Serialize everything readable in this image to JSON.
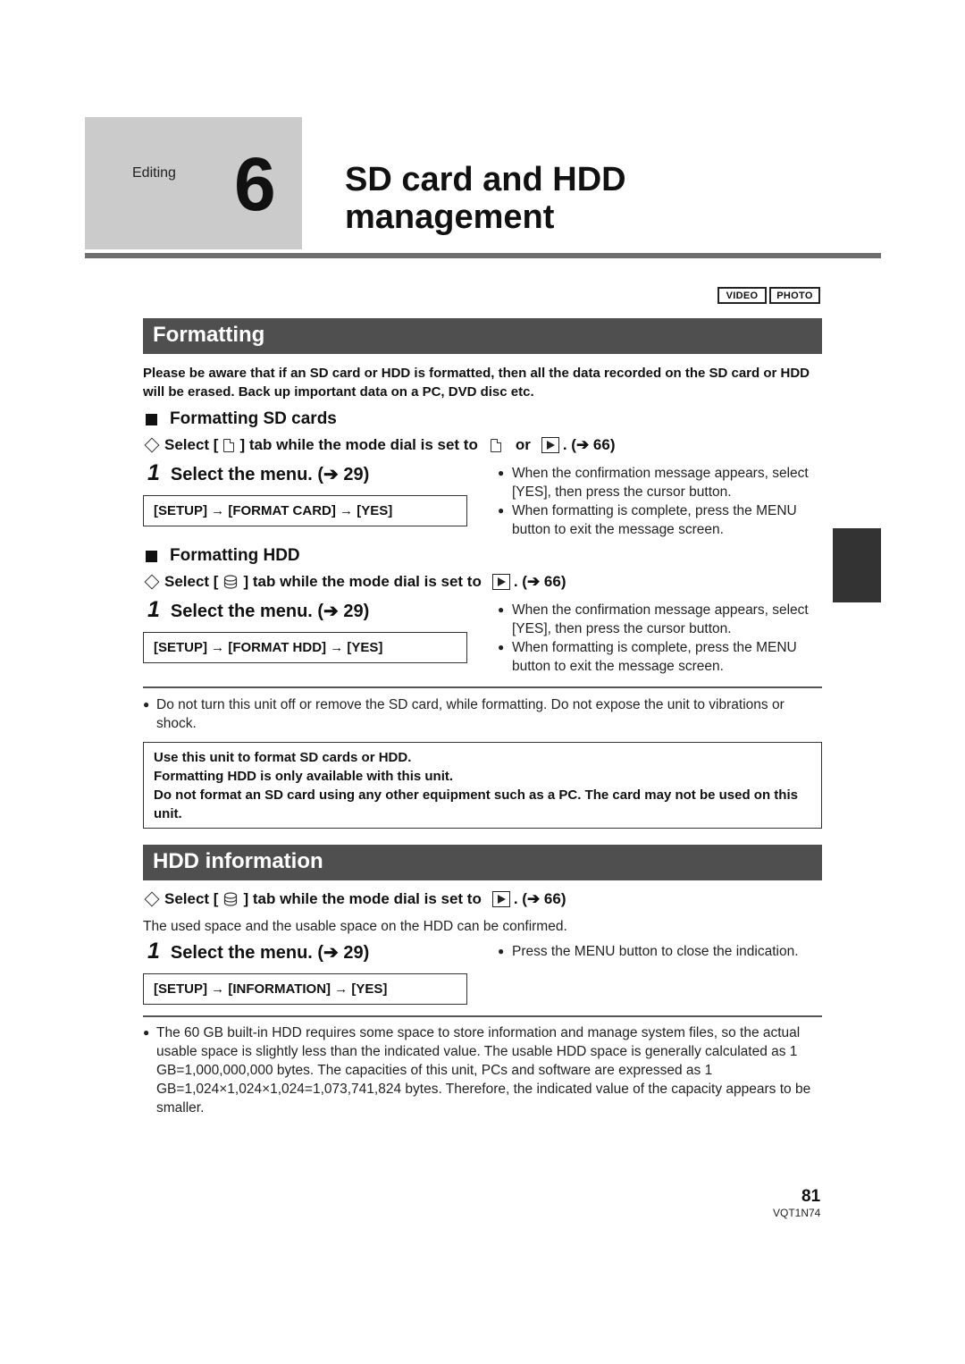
{
  "header": {
    "chapter_label": "Editing",
    "chapter_number": "6",
    "title_line1": "SD card and HDD",
    "title_line2": "management"
  },
  "mode_badges": [
    "VIDEO",
    "PHOTO"
  ],
  "formatting": {
    "section_title": "Formatting",
    "warning": "Please be aware that if an SD card or HDD is formatted, then all the data recorded on the SD card or HDD will be erased. Back up important data on a PC, DVD disc etc.",
    "sd": {
      "heading": "Formatting SD cards",
      "select_prefix": "Select [",
      "select_middle": "] tab while the mode dial is set to",
      "select_or": "or",
      "select_ref": ". (➔ 66)",
      "tab_icon": "sd-card-icon",
      "mode_icons": [
        "sd-card-icon",
        "playback-icon"
      ],
      "step_number": "1",
      "step_text": "Select the menu. (➔ 29)",
      "menu_path": "[SETUP] → [FORMAT CARD] → [YES]",
      "bullets": [
        "When the confirmation message appears, select [YES], then press the cursor button.",
        "When formatting is complete, press the MENU button to exit the message screen."
      ]
    },
    "hdd": {
      "heading": "Formatting HDD",
      "select_prefix": "Select [",
      "select_middle": "] tab while the mode dial is set to",
      "select_ref": ". (➔ 66)",
      "tab_icon": "hdd-icon",
      "mode_icons": [
        "playback-icon"
      ],
      "step_number": "1",
      "step_text": "Select the menu. (➔ 29)",
      "menu_path": "[SETUP] → [FORMAT HDD] → [YES]",
      "bullets": [
        "When the confirmation message appears, select [YES], then press the cursor button.",
        "When formatting is complete, press the MENU button to exit the message screen."
      ]
    },
    "note": "Do not turn this unit off or remove the SD card, while formatting. Do not expose the unit to vibrations or shock.",
    "notice_lines": [
      "Use this unit to format SD cards or HDD.",
      "Formatting HDD is only available with this unit.",
      "Do not format an SD card using any other equipment such as a PC. The card may not be used on this unit."
    ]
  },
  "hdd_information": {
    "section_title": "HDD information",
    "select_prefix": "Select [",
    "select_middle": "] tab while the mode dial is set to",
    "select_ref": ". (➔ 66)",
    "tab_icon": "hdd-icon",
    "mode_icons": [
      "playback-icon"
    ],
    "description": "The used space and the usable space on the HDD can be confirmed.",
    "step_number": "1",
    "step_text": "Select the menu. (➔ 29)",
    "menu_path": "[SETUP] → [INFORMATION] → [YES]",
    "bullets": [
      "Press the MENU button to close the indication."
    ],
    "note": "The 60 GB built-in HDD requires some space to store information and manage system files, so the actual usable space is slightly less than the indicated value. The usable HDD space is generally calculated as 1 GB=1,000,000,000 bytes. The capacities of this unit, PCs and software are expressed as 1 GB=1,024×1,024×1,024=1,073,741,824 bytes. Therefore, the indicated value of the capacity appears to be smaller."
  },
  "footer": {
    "page_number": "81",
    "doc_code": "VQT1N74"
  },
  "colors": {
    "section_bar": "#4f4f4f",
    "chapter_box": "#cbcbcb",
    "side_tab": "#333333"
  }
}
